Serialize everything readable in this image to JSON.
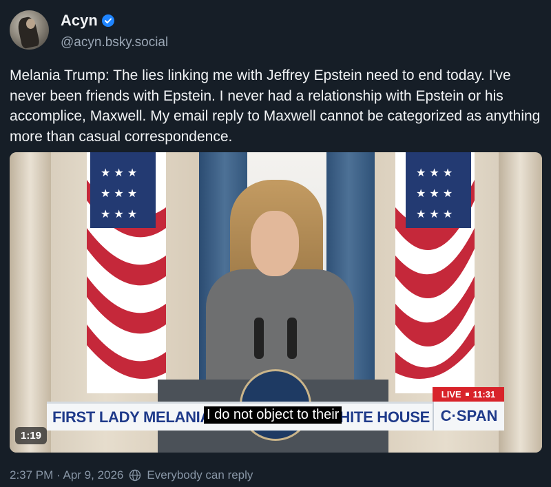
{
  "author": {
    "display_name": "Acyn",
    "handle": "@acyn.bsky.social",
    "verified_icon": "verified-badge-icon"
  },
  "post": {
    "text": "Melania Trump: The lies linking me with Jeffrey Epstein need to end today. I've never been friends with Epstein. I never had a relationship with Epstein or his accomplice, Maxwell. My email reply to Maxwell cannot be categorized as anything more than casual correspondence."
  },
  "video": {
    "duration": "1:19",
    "lower_third_left": "FIRST LADY MELANIA T",
    "lower_third_right": "HITE HOUSE",
    "caption": "I do not object to their",
    "network": "C·SPAN",
    "live_label": "LIVE",
    "live_time": "11:31"
  },
  "meta": {
    "timestamp": "2:37 PM · Apr 9, 2026",
    "reply_setting": "Everybody can reply",
    "reply_icon": "globe-icon"
  },
  "colors": {
    "background": "#161e27",
    "text_primary": "#f1f3f5",
    "text_secondary": "#9aa6b4",
    "verified": "#1f85ff",
    "cspan_blue": "#1f3a8a",
    "live_red": "#d8232a"
  }
}
